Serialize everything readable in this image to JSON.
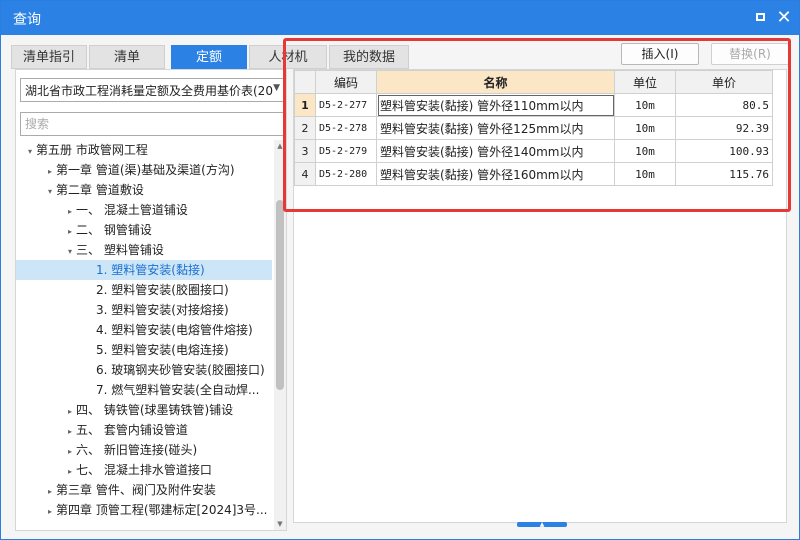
{
  "window": {
    "title": "查询"
  },
  "tabs": [
    {
      "label": "清单指引",
      "active": false
    },
    {
      "label": "清单",
      "active": false
    },
    {
      "label": "定额",
      "active": true
    },
    {
      "label": "人材机",
      "active": false
    },
    {
      "label": "我的数据",
      "active": false
    }
  ],
  "left": {
    "library": "湖北省市政工程消耗量定额及全费用基价表(20",
    "search_placeholder": "搜索",
    "tree": [
      {
        "label": "第五册 市政管网工程",
        "level": 0,
        "arrow": "▾"
      },
      {
        "label": "第一章 管道(渠)基础及渠道(方沟)",
        "level": 1,
        "arrow": "▸"
      },
      {
        "label": "第二章 管道敷设",
        "level": 1,
        "arrow": "▾"
      },
      {
        "label": "一、 混凝土管道铺设",
        "level": 2,
        "arrow": "▸"
      },
      {
        "label": "二、 钢管铺设",
        "level": 2,
        "arrow": "▸"
      },
      {
        "label": "三、 塑料管铺设",
        "level": 2,
        "arrow": "▾"
      },
      {
        "label": "1. 塑料管安装(黏接)",
        "level": 3,
        "arrow": "",
        "selected": true
      },
      {
        "label": "2. 塑料管安装(胶圈接口)",
        "level": 3,
        "arrow": ""
      },
      {
        "label": "3. 塑料管安装(对接熔接)",
        "level": 3,
        "arrow": ""
      },
      {
        "label": "4. 塑料管安装(电熔管件熔接)",
        "level": 3,
        "arrow": ""
      },
      {
        "label": "5. 塑料管安装(电熔连接)",
        "level": 3,
        "arrow": ""
      },
      {
        "label": "6. 玻璃钢夹砂管安装(胶圈接口)",
        "level": 3,
        "arrow": ""
      },
      {
        "label": "7. 燃气塑料管安装(全自动焊...",
        "level": 3,
        "arrow": ""
      },
      {
        "label": "四、 铸铁管(球墨铸铁管)铺设",
        "level": 2,
        "arrow": "▸"
      },
      {
        "label": "五、 套管内铺设管道",
        "level": 2,
        "arrow": "▸"
      },
      {
        "label": "六、 新旧管连接(碰头)",
        "level": 2,
        "arrow": "▸"
      },
      {
        "label": "七、 混凝土排水管道接口",
        "level": 2,
        "arrow": "▸"
      },
      {
        "label": "第三章 管件、阀门及附件安装",
        "level": 1,
        "arrow": "▸"
      },
      {
        "label": "第四章 顶管工程(鄂建标定[2024]3号...",
        "level": 1,
        "arrow": "▸"
      }
    ]
  },
  "actions": {
    "insert": "插入(I)",
    "replace": "替换(R)"
  },
  "grid": {
    "columns": [
      "编码",
      "名称",
      "单位",
      "单价"
    ],
    "rows": [
      {
        "num": "1",
        "code": "D5-2-277",
        "name": "塑料管安装(黏接) 管外径110mm以内",
        "unit": "10m",
        "price": "80.5"
      },
      {
        "num": "2",
        "code": "D5-2-278",
        "name": "塑料管安装(黏接) 管外径125mm以内",
        "unit": "10m",
        "price": "92.39"
      },
      {
        "num": "3",
        "code": "D5-2-279",
        "name": "塑料管安装(黏接) 管外径140mm以内",
        "unit": "10m",
        "price": "100.93"
      },
      {
        "num": "4",
        "code": "D5-2-280",
        "name": "塑料管安装(黏接) 管外径160mm以内",
        "unit": "10m",
        "price": "115.76"
      }
    ]
  },
  "colors": {
    "accent": "#2b82e4",
    "highlight": "#e53935",
    "header_name": "#fbe7c6"
  }
}
